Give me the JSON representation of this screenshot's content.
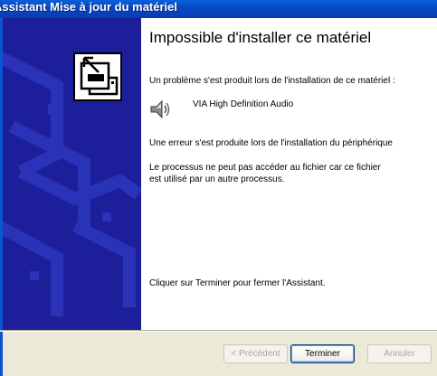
{
  "window": {
    "title": "Assistant Mise à jour du matériel"
  },
  "content": {
    "heading": "Impossible d'installer ce matériel",
    "problem_text": "Un problème s'est produit lors de l'installation de ce matériel :",
    "device_name": "VIA High Definition Audio",
    "error_text": "Une erreur s'est produite lors de l'installation du périphérique",
    "detail_line1": "Le processus ne peut pas accéder au fichier car ce fichier",
    "detail_line2": "est utilisé par un autre processus.",
    "finish_instruction": "Cliquer sur Terminer pour fermer l'Assistant."
  },
  "buttons": {
    "previous": "< Précédent",
    "finish": "Terminer",
    "cancel": "Annuler"
  },
  "icons": {
    "wizard": "hardware-wizard-icon",
    "device": "speaker-icon"
  },
  "colors": {
    "sidebar": "#1c1f99",
    "titlebar": "#0746c4"
  }
}
